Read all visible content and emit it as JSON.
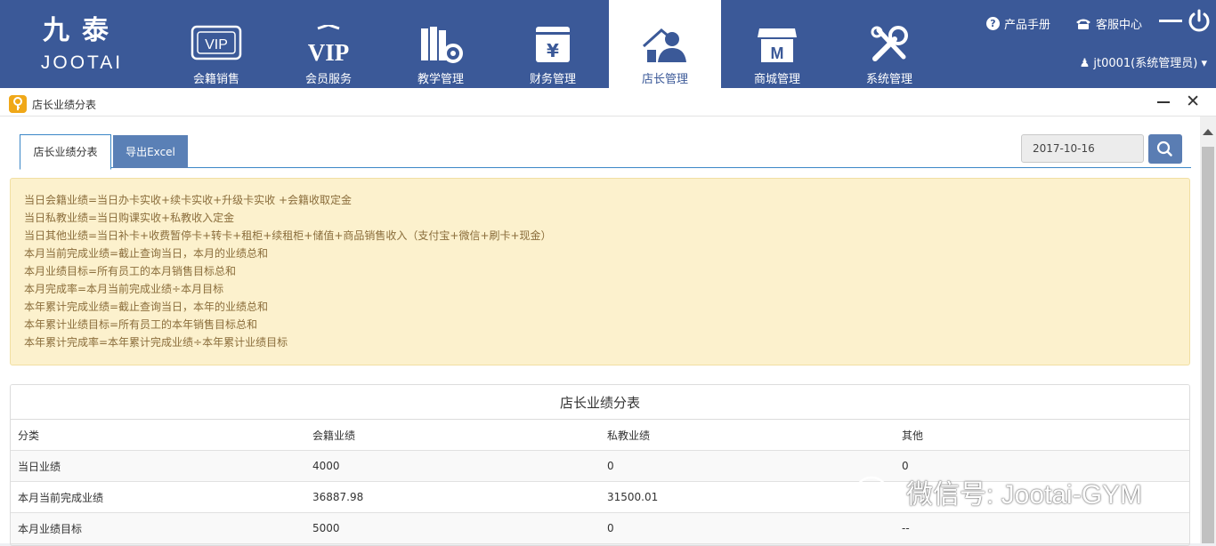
{
  "brand": {
    "cn": "九泰",
    "en": "JOOTAI"
  },
  "nav": [
    {
      "label": "会籍销售",
      "icon": "vip-card-icon"
    },
    {
      "label": "会员服务",
      "icon": "vip-badge-icon"
    },
    {
      "label": "教学管理",
      "icon": "books-gear-icon"
    },
    {
      "label": "财务管理",
      "icon": "yuan-document-icon"
    },
    {
      "label": "店长管理",
      "icon": "manager-icon",
      "active": true
    },
    {
      "label": "商城管理",
      "icon": "store-icon"
    },
    {
      "label": "系统管理",
      "icon": "tools-icon"
    }
  ],
  "header_right": {
    "manual": "产品手册",
    "service": "客服中心",
    "user": "jt0001(系统管理员)"
  },
  "panel": {
    "title": "店长业绩分表"
  },
  "tabs": {
    "report": "店长业绩分表",
    "export": "导出Excel"
  },
  "date": {
    "value": "2017-10-16"
  },
  "info_lines": [
    "当日会籍业绩=当日办卡实收+续卡实收+升级卡实收 +会籍收取定金",
    "当日私教业绩=当日购课实收+私教收入定金",
    "当日其他业绩=当日补卡+收费暂停卡+转卡+租柜+续租柜+储值+商品销售收入（支付宝+微信+刷卡+现金）",
    "本月当前完成业绩=截止查询当日，本月的业绩总和",
    "本月业绩目标=所有员工的本月销售目标总和",
    "本月完成率=本月当前完成业绩÷本月目标",
    "本年累计完成业绩=截止查询当日，本年的业绩总和",
    "本年累计业绩目标=所有员工的本年销售目标总和",
    "本年累计完成率=本年累计完成业绩÷本年累计业绩目标"
  ],
  "table": {
    "title": "店长业绩分表",
    "headers": [
      "分类",
      "会籍业绩",
      "私教业绩",
      "其他"
    ],
    "rows": [
      [
        "当日业绩",
        "4000",
        "0",
        "0"
      ],
      [
        "本月当前完成业绩",
        "36887.98",
        "31500.01",
        ""
      ],
      [
        "本月业绩目标",
        "5000",
        "0",
        "--"
      ]
    ]
  },
  "watermark": "微信号: Jootai-GYM",
  "colors": {
    "topbar": "#3b5998",
    "accent": "#5a80b6",
    "info_bg": "#fcf1cd",
    "info_text": "#8a6d3b"
  }
}
